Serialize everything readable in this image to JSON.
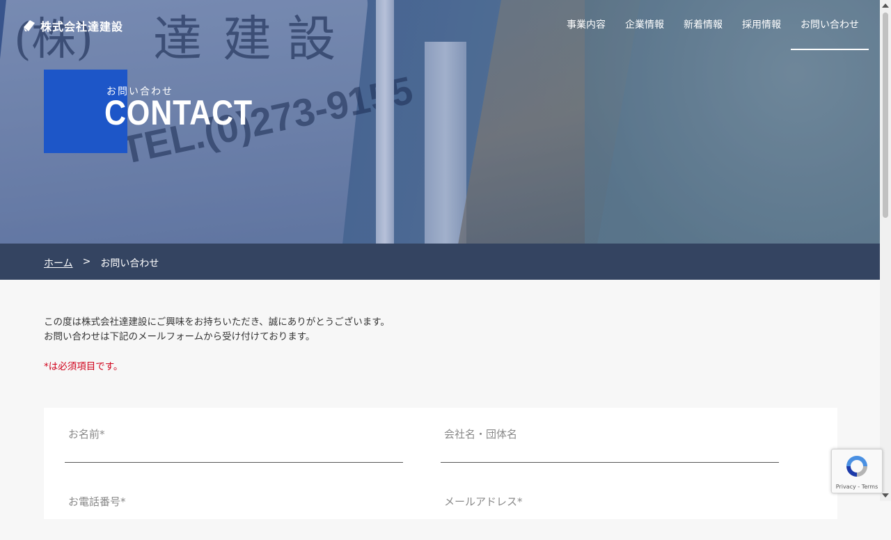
{
  "header": {
    "logo_text": "株式会社達建設",
    "nav": [
      {
        "label": "事業内容"
      },
      {
        "label": "企業情報"
      },
      {
        "label": "新着情報"
      },
      {
        "label": "採用情報"
      },
      {
        "label": "お問い合わせ",
        "active": true
      }
    ]
  },
  "hero": {
    "truck_text_1": "(株)",
    "truck_text_2": "達",
    "truck_text_3": "建 設",
    "truck_tel": "TEL.(0)273-9155",
    "subtitle": "お問い合わせ",
    "title": "CONTACT"
  },
  "breadcrumb": {
    "home": "ホーム",
    "separator": ">",
    "current": "お問い合わせ"
  },
  "intro": {
    "line1": "この度は株式会社達建設にご興味をお持ちいただき、誠にありがとうございます。",
    "line2": "お問い合わせは下記のメールフォームから受け付けております。",
    "required_note": "*は必須項目です。"
  },
  "form": {
    "name_placeholder": "お名前*",
    "company_placeholder": "会社名・団体名",
    "phone_placeholder": "お電話番号*",
    "email_placeholder": "メールアドレス*"
  },
  "recaptcha": {
    "terms": "Privacy - Terms"
  },
  "colors": {
    "accent_blue": "#1d56c8",
    "breadcrumb_bg": "#344461",
    "required_red": "#d0021b"
  }
}
